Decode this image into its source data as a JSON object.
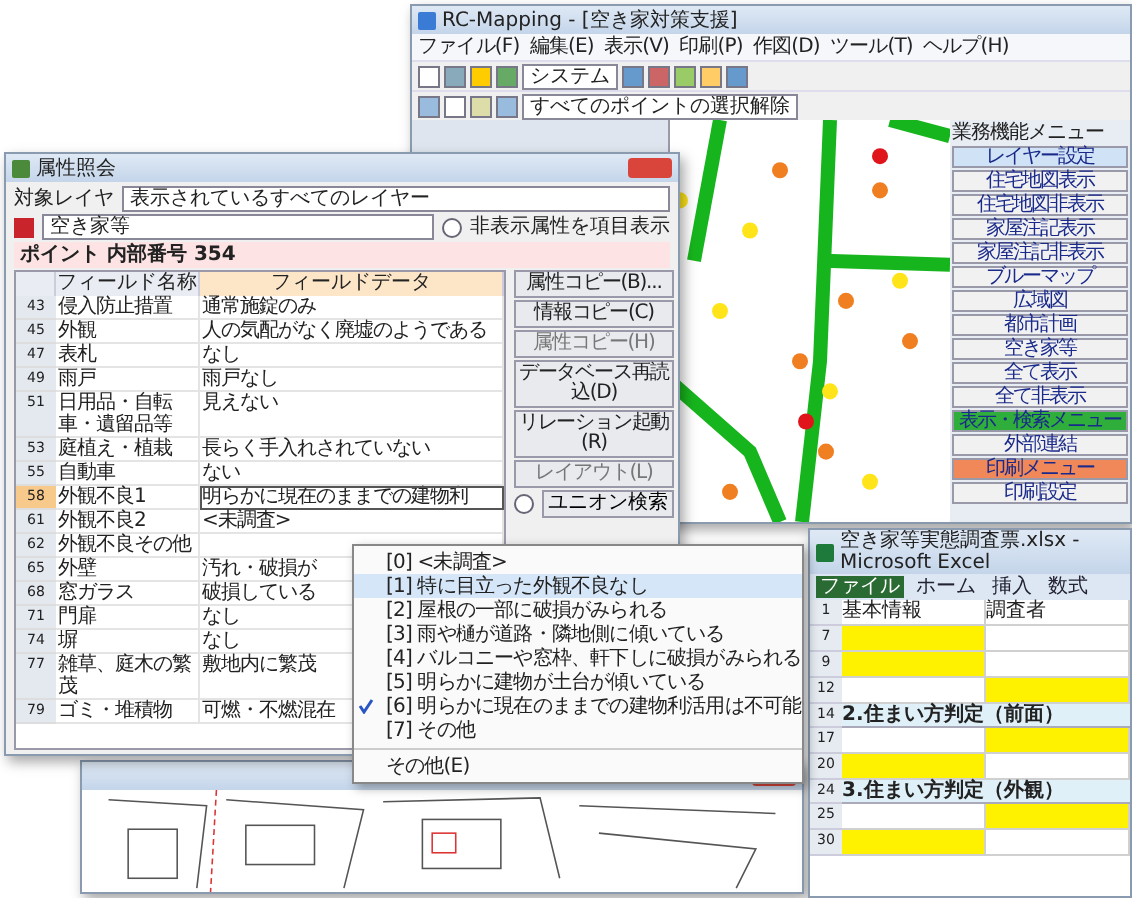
{
  "main_window": {
    "title": "RC-Mapping - [空き家対策支援]",
    "menu": [
      "ファイル(F)",
      "編集(E)",
      "表示(V)",
      "印刷(P)",
      "作図(D)",
      "ツール(T)",
      "ヘルプ(H)"
    ],
    "toolbar_field": "システム",
    "toolbar_action": "すべてのポイントの選択解除",
    "side_panel": {
      "title": "業務機能メニュー",
      "buttons": [
        {
          "label": "レイヤー設定",
          "color": "#cfe2f6"
        },
        {
          "label": "住宅地図表示",
          "color": "#f1f1f1"
        },
        {
          "label": "住宅地図非表示",
          "color": "#f1f1f1"
        },
        {
          "label": "家屋注記表示",
          "color": "#f1f1f1"
        },
        {
          "label": "家屋注記非表示",
          "color": "#f1f1f1"
        },
        {
          "label": "ブルーマップ",
          "color": "#f1f1f1"
        },
        {
          "label": "広域図",
          "color": "#f1f1f1"
        },
        {
          "label": "都市計画",
          "color": "#f1f1f1"
        },
        {
          "label": "空き家等",
          "color": "#f1f1f1"
        },
        {
          "label": "全て表示",
          "color": "#f1f1f1"
        },
        {
          "label": "全て非表示",
          "color": "#f1f1f1"
        },
        {
          "label": "表示・検索メニュー",
          "color": "#2fae3c"
        },
        {
          "label": "外部連結",
          "color": "#f1f1f1"
        },
        {
          "label": "印刷メニュー",
          "color": "#f0885a"
        },
        {
          "label": "印刷設定",
          "color": "#f1f1f1"
        }
      ]
    }
  },
  "attribute_dialog": {
    "title": "属性照会",
    "layer_label": "対象レイヤ",
    "layer_value": "表示されているすべてのレイヤー",
    "category": "空き家等",
    "hide_toggle": {
      "label": "非表示属性を項目表示",
      "checked": false
    },
    "point_label": "ポイント 内部番号 354",
    "columns": [
      "フィールド名称",
      "フィールドデータ"
    ],
    "rows": [
      {
        "number": "43",
        "field": "侵入防止措置",
        "value": "通常施錠のみ",
        "selected": false
      },
      {
        "number": "45",
        "field": "外観",
        "value": "人の気配がなく廃墟のようである",
        "selected": false
      },
      {
        "number": "47",
        "field": "表札",
        "value": "なし",
        "selected": false
      },
      {
        "number": "49",
        "field": "雨戸",
        "value": "雨戸なし",
        "selected": false
      },
      {
        "number": "51",
        "field": "日用品・自転車・遺留品等",
        "value": "見えない",
        "selected": false
      },
      {
        "number": "53",
        "field": "庭植え・植栽",
        "value": "長らく手入れされていない",
        "selected": false
      },
      {
        "number": "55",
        "field": "自動車",
        "value": "ない",
        "selected": false
      },
      {
        "number": "58",
        "field": "外観不良1",
        "value": "明らかに現在のままでの建物利",
        "selected": true
      },
      {
        "number": "61",
        "field": "外観不良2",
        "value": "<未調査>",
        "selected": false
      },
      {
        "number": "62",
        "field": "外観不良その他",
        "selected": false
      },
      {
        "number": "65",
        "field": "外壁",
        "value": "汚れ・破損が",
        "selected": false
      },
      {
        "number": "68",
        "field": "窓ガラス",
        "value": "破損している",
        "selected": false
      },
      {
        "number": "71",
        "field": "門扉",
        "value": "なし",
        "selected": false
      },
      {
        "number": "74",
        "field": "塀",
        "value": "なし",
        "selected": false
      },
      {
        "number": "77",
        "field": "雑草、庭木の繁茂",
        "value": "敷地内に繁茂",
        "selected": false
      },
      {
        "number": "79",
        "field": "ゴミ・堆積物",
        "value": "可燃・不燃混在",
        "selected": false
      }
    ],
    "buttons": [
      {
        "label": "属性コピー(B)...",
        "disabled": false
      },
      {
        "label": "情報コピー(C)",
        "disabled": false
      },
      {
        "label": "属性コピー(H)",
        "disabled": true
      },
      {
        "label": "データベース再読込(D)",
        "disabled": false
      },
      {
        "label": "リレーション起動(R)",
        "disabled": false
      },
      {
        "label": "レイアウト(L)",
        "disabled": true
      }
    ],
    "union_search": "ユニオン検索"
  },
  "popup_menu": {
    "items": [
      {
        "kind": "option",
        "label": "[0] <未調査>",
        "selected": false,
        "checked": false
      },
      {
        "kind": "option",
        "label": "[1] 特に目立った外観不良なし",
        "selected": true,
        "checked": false
      },
      {
        "kind": "option",
        "label": "[2] 屋根の一部に破損がみられる",
        "selected": false,
        "checked": false
      },
      {
        "kind": "option",
        "label": "[3] 雨や樋が道路・隣地側に傾いている",
        "selected": false,
        "checked": false
      },
      {
        "kind": "option",
        "label": "[4] バルコニーや窓枠、軒下しに破損がみられる",
        "selected": false,
        "checked": false
      },
      {
        "kind": "option",
        "label": "[5] 明らかに建物が土台が傾いている",
        "selected": false,
        "checked": false
      },
      {
        "kind": "option",
        "label": "[6] 明らかに現在のままでの建物利活用は不可能",
        "selected": false,
        "checked": true
      },
      {
        "kind": "option",
        "label": "[7] その他",
        "selected": false,
        "checked": false
      },
      {
        "kind": "command",
        "label": "その他(E)",
        "selected": false,
        "checked": false
      }
    ]
  },
  "excel_window": {
    "title": "空き家等実態調査票.xlsx - Microsoft Excel",
    "tabs": [
      {
        "label": "ファイル",
        "selected": true
      },
      {
        "label": "ホーム",
        "selected": false
      },
      {
        "label": "挿入",
        "selected": false
      },
      {
        "label": "数式",
        "selected": false
      }
    ],
    "rows": [
      {
        "number": "1",
        "cells": [
          {
            "text": "基本情報",
            "highlight": false
          },
          {
            "text": "調査者",
            "highlight": false
          }
        ]
      },
      {
        "number": "7",
        "cells": [
          {
            "highlight": true
          },
          {
            "highlight": false
          }
        ]
      },
      {
        "number": "9",
        "cells": [
          {
            "highlight": true
          },
          {
            "highlight": false
          }
        ]
      },
      {
        "number": "12",
        "cells": [
          {
            "highlight": false
          },
          {
            "highlight": true
          }
        ]
      },
      {
        "number": "14",
        "heading": "2.住まい方判定（前面）"
      },
      {
        "number": "17",
        "cells": [
          {
            "highlight": false
          },
          {
            "highlight": true
          }
        ]
      },
      {
        "number": "20",
        "cells": [
          {
            "highlight": true
          },
          {
            "highlight": false
          }
        ]
      },
      {
        "number": "24",
        "heading": "3.住まい方判定（外観）"
      },
      {
        "number": "25",
        "cells": [
          {
            "highlight": false
          },
          {
            "highlight": true
          }
        ]
      },
      {
        "number": "30",
        "cells": [
          {
            "highlight": true
          },
          {
            "highlight": false
          }
        ]
      }
    ]
  }
}
